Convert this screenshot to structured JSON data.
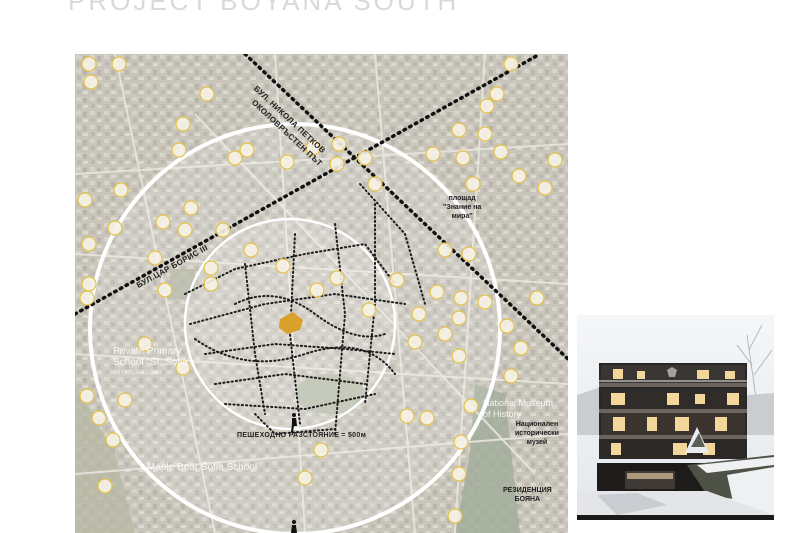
{
  "page": {
    "title": "PROJECT BOYANA SOUTH"
  },
  "map": {
    "roads": {
      "nikola_petkov": "БУЛ. НИКОЛА ПЕТКОВ",
      "okolovrasten": "ОКОЛОВРЪСТЕН ПЪТ",
      "tsar_boris": "БУЛ.ЦАР БОРИС III"
    },
    "walking_distance": "ПЕШЕХОДНО РАЗСТОЯНИЕ = 500м",
    "square_label": "площад\n\"Знание на\nмира\"",
    "museum_label": "Национален\nисторически\nмузей",
    "residence_label": "РЕЗИДЕНЦИЯ\nБОЯНА",
    "poi_school_1": "Private Primary\nSchool \"St. Sofia\"",
    "poi_school_1_sub": "ЧНУ \"Св. София\"",
    "poi_school_2": "Maple Bear Sofia School",
    "poi_museum": "National Museum\nof History",
    "project_color": "#d9a12c",
    "icon_color": "#e3c24a"
  },
  "photo": {
    "icon": "building-photo"
  }
}
